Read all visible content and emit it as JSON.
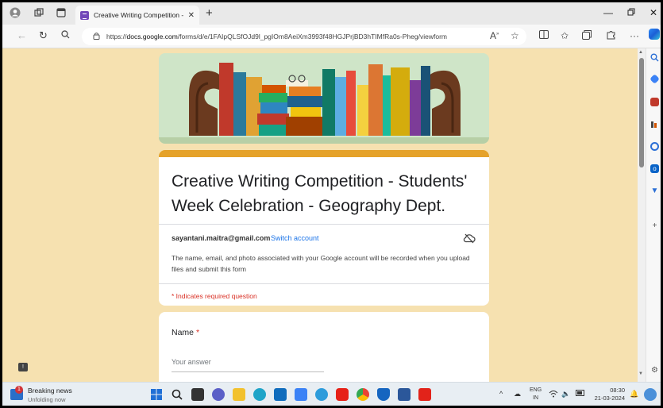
{
  "browser": {
    "tab_title": "Creative Writing Competition - St",
    "url_prefix": "https://",
    "url_domain": "docs.google.com",
    "url_path": "/forms/d/e/1FAIpQLSfOJd9l_pgIOm8AeiXm3993f48HGJPrjBD3hTIMfRa0s-Pheg/viewform"
  },
  "form": {
    "title": "Creative Writing Competition - Students' Week Celebration - Geography Dept.",
    "account_email": "sayantani.maitra@gmail.com",
    "switch_account": "Switch account",
    "notice": "The name, email, and photo associated with your Google account will be recorded when you upload files and submit this form",
    "required_note": "* Indicates required question",
    "question_name_label": "Name",
    "question_required_star": "*",
    "answer_placeholder": "Your answer"
  },
  "taskbar": {
    "news_title": "Breaking news",
    "news_subtitle": "Unfolding now",
    "news_badge": "1",
    "lang_top": "ENG",
    "lang_bottom": "IN",
    "time": "08:30",
    "date": "21-03-2024"
  },
  "colors": {
    "form_accent": "#e5a22a",
    "page_background": "#f6e1b0",
    "link": "#1a73e8",
    "required": "#d93025"
  }
}
